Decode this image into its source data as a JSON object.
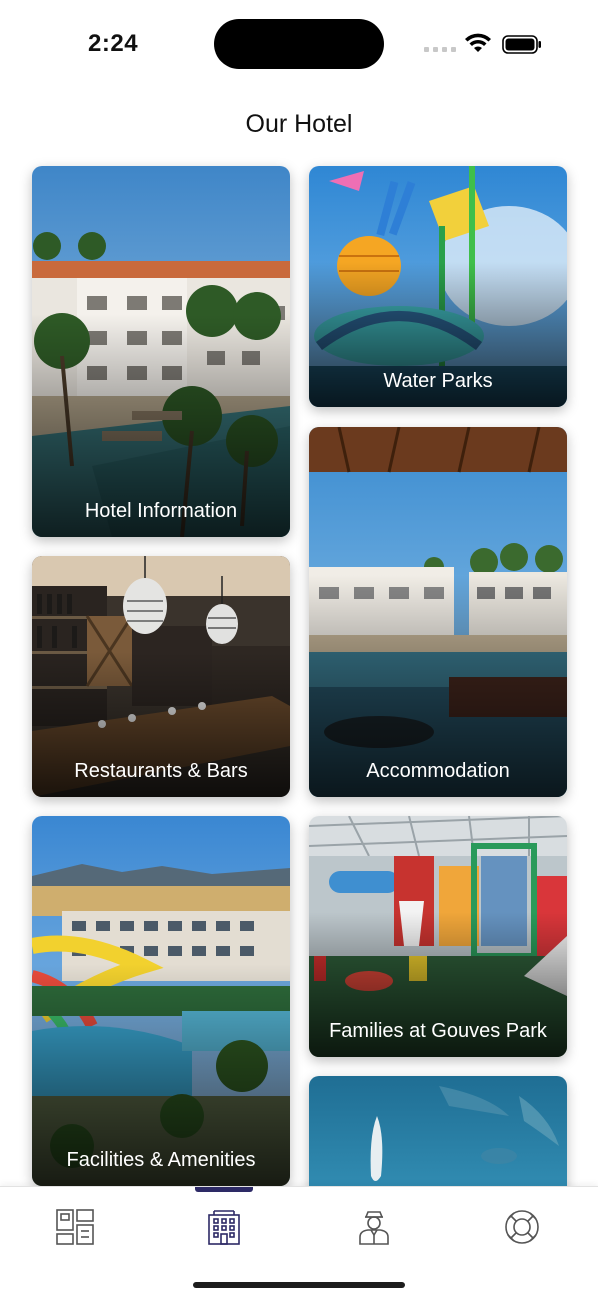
{
  "status_bar": {
    "time": "2:24"
  },
  "header": {
    "title": "Our Hotel"
  },
  "cards": {
    "hotel_information": "Hotel Information",
    "water_parks": "Water Parks",
    "restaurants_bars": "Restaurants & Bars",
    "accommodation": "Accommodation",
    "facilities_amenities": "Facilities & Amenities",
    "families": "Families at Gouves Park"
  },
  "tab_bar": {
    "selected_index": 1,
    "accent_color": "#2d2a66",
    "icon_color": "#555555",
    "tabs": [
      {
        "icon": "dashboard-grid-icon"
      },
      {
        "icon": "hotel-building-icon"
      },
      {
        "icon": "concierge-staff-icon"
      },
      {
        "icon": "lifebuoy-icon"
      }
    ]
  }
}
